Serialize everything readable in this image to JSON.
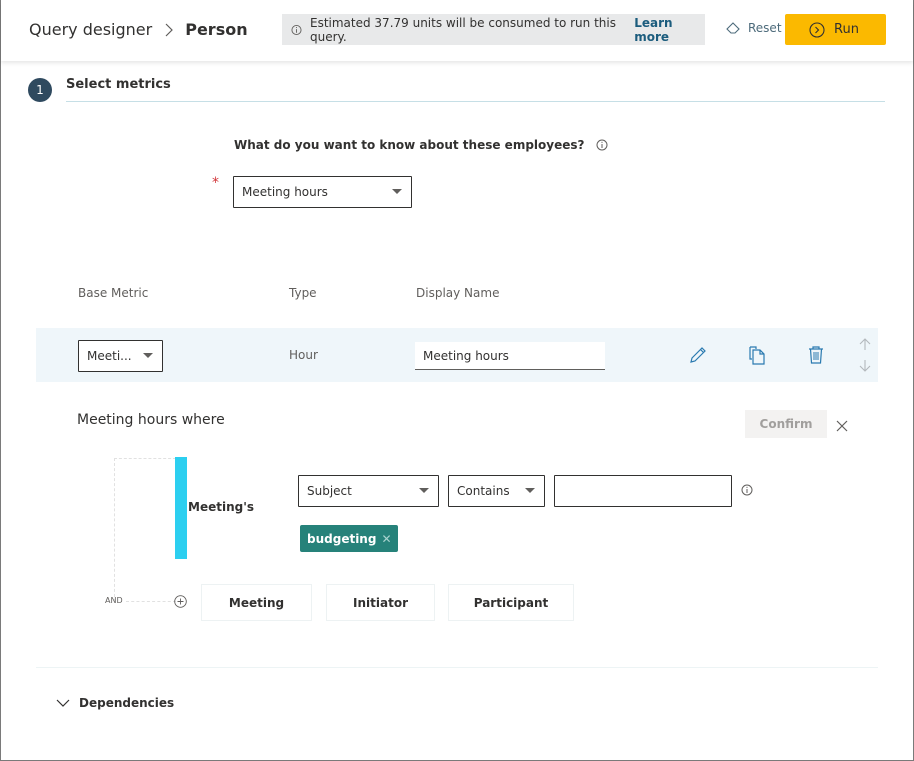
{
  "header": {
    "breadcrumb_root": "Query designer",
    "breadcrumb_current": "Person",
    "estimate_text": "Estimated 37.79 units will be consumed to run this query.",
    "learn_more": "Learn more",
    "reset_label": "Reset",
    "run_label": "Run"
  },
  "step": {
    "number": "1",
    "title": "Select metrics"
  },
  "question": {
    "label": "What do you want to know about these employees?",
    "required_mark": "*",
    "selected_metric": "Meeting hours"
  },
  "table": {
    "headers": [
      "Base Metric",
      "Type",
      "Display Name"
    ],
    "rows": [
      {
        "base_metric": "Meeti...",
        "type": "Hour",
        "display_name": "Meeting hours"
      }
    ]
  },
  "filter": {
    "title": "Meeting hours where",
    "confirm_label": "Confirm",
    "entity_label": "Meeting's",
    "attribute": "Subject",
    "operator": "Contains",
    "value_input": "",
    "tags": [
      "budgeting"
    ],
    "tag_remove_glyph": "✕",
    "logic_label": "AND",
    "add_buttons": [
      "Meeting",
      "Initiator",
      "Participant"
    ]
  },
  "dependencies": {
    "label": "Dependencies"
  },
  "colors": {
    "run_button": "#fbb900",
    "step_circle": "#2f4a5f",
    "tag": "#26827a",
    "entity_bar": "#2ccff0",
    "link": "#1b5c7d",
    "row_highlight": "#eff6fa"
  }
}
